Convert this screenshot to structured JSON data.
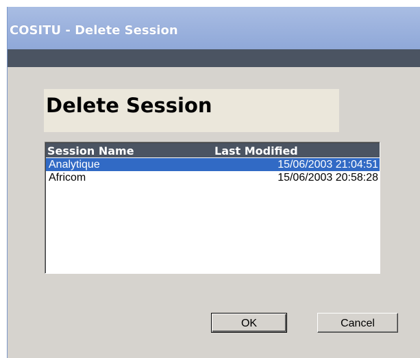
{
  "window": {
    "title": "COSITU - Delete Session"
  },
  "dialog": {
    "heading": "Delete Session"
  },
  "sessions_list": {
    "columns": [
      "Session Name",
      "Last Modified"
    ],
    "rows": [
      {
        "name": "Analytique",
        "last_modified": "15/06/2003 21:04:51",
        "selected": true
      },
      {
        "name": "Africom",
        "last_modified": "15/06/2003 20:58:28",
        "selected": false
      }
    ]
  },
  "buttons": {
    "ok_label": "OK",
    "cancel_label": "Cancel"
  },
  "colors": {
    "titlebar": "#9db3de",
    "header_bar": "#4b5462",
    "selection": "#316ac5",
    "dialog_bg": "#d6d3ce"
  }
}
